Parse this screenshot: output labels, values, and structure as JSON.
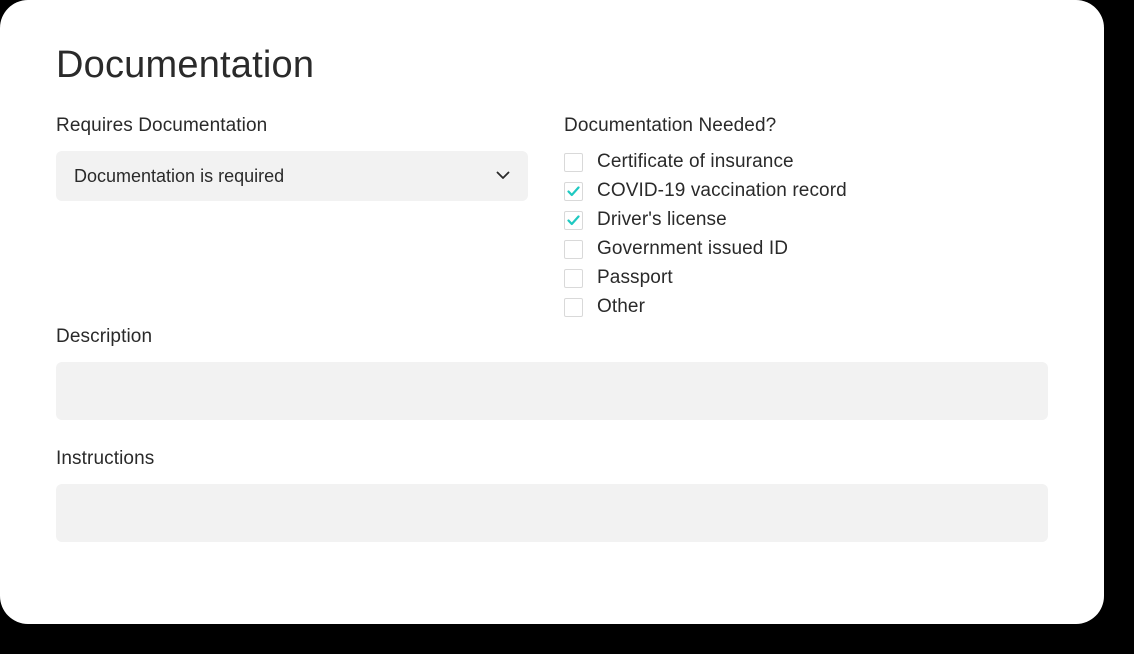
{
  "title": "Documentation",
  "requires": {
    "label": "Requires Documentation",
    "selected": "Documentation is required"
  },
  "needed": {
    "label": "Documentation Needed?",
    "items": [
      {
        "label": "Certificate of insurance",
        "checked": false
      },
      {
        "label": "COVID-19 vaccination record",
        "checked": true
      },
      {
        "label": "Driver's license",
        "checked": true
      },
      {
        "label": "Government issued ID",
        "checked": false
      },
      {
        "label": "Passport",
        "checked": false
      },
      {
        "label": "Other",
        "checked": false
      }
    ]
  },
  "description": {
    "label": "Description",
    "value": ""
  },
  "instructions": {
    "label": "Instructions",
    "value": ""
  },
  "colors": {
    "accent": "#1fc9c1"
  }
}
